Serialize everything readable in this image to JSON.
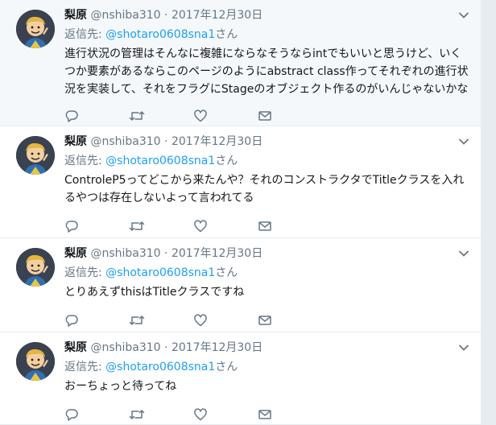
{
  "tweets": [
    {
      "name": "梨原",
      "handle": "@nshiba310",
      "separator": "·",
      "time": "2017年12月30日",
      "reply_prefix": "返信先: ",
      "reply_to": "@shotaro0608sna1",
      "reply_suffix": "さん",
      "text": "進行状況の管理はそんなに複雑にならなそうならintでもいいと思うけど、いくつか要素があるならこのページのようにabstract class作ってそれぞれの進行状況を実装して、それをフラグにStageのオブジェクト作るのがいんじゃないかな"
    },
    {
      "name": "梨原",
      "handle": "@nshiba310",
      "separator": "·",
      "time": "2017年12月30日",
      "reply_prefix": "返信先: ",
      "reply_to": "@shotaro0608sna1",
      "reply_suffix": "さん",
      "text": "ControleP5ってどこから来たんや？それのコンストラクタでTitleクラスを入れるやつは存在しないよって言われてる"
    },
    {
      "name": "梨原",
      "handle": "@nshiba310",
      "separator": "·",
      "time": "2017年12月30日",
      "reply_prefix": "返信先: ",
      "reply_to": "@shotaro0608sna1",
      "reply_suffix": "さん",
      "text": "とりあえずthisはTitleクラスですね"
    },
    {
      "name": "梨原",
      "handle": "@nshiba310",
      "separator": "·",
      "time": "2017年12月30日",
      "reply_prefix": "返信先: ",
      "reply_to": "@shotaro0608sna1",
      "reply_suffix": "さん",
      "text": "おーちょっと待ってね"
    }
  ],
  "icons": {
    "reply": "reply-icon",
    "retweet": "retweet-icon",
    "like": "heart-icon",
    "dm": "envelope-icon",
    "menu": "chevron-down-icon"
  },
  "colors": {
    "link": "#1da1f2",
    "muted": "#657786",
    "highlight_bg": "#f5f8fa"
  }
}
